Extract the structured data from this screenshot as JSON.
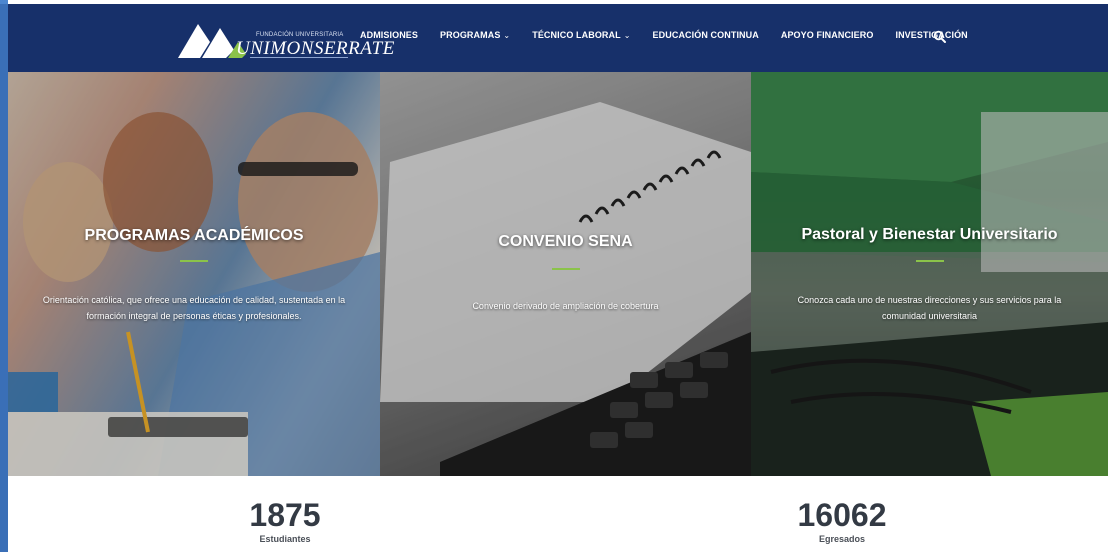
{
  "brand": {
    "foundation_text": "FUNDACIÓN UNIVERSITARIA",
    "name": "UNIMONSERRATE"
  },
  "nav": {
    "items": [
      {
        "label": "ADMISIONES",
        "has_dropdown": false
      },
      {
        "label": "PROGRAMAS",
        "has_dropdown": true
      },
      {
        "label": "TÉCNICO LABORAL",
        "has_dropdown": true
      },
      {
        "label": "EDUCACIÓN CONTINUA",
        "has_dropdown": false
      },
      {
        "label": "APOYO FINANCIERO",
        "has_dropdown": false
      },
      {
        "label": "INVESTIGACIÓN",
        "has_dropdown": false
      }
    ],
    "search_icon": "search-icon"
  },
  "panels": [
    {
      "title": "PROGRAMAS ACADÉMICOS",
      "description": "Orientación católica, que ofrece una educación de calidad, sustentada en la formación integral de personas éticas y profesionales."
    },
    {
      "title": "CONVENIO SENA",
      "description": "Convenio derivado de ampliación de cobertura"
    },
    {
      "title": "Pastoral y Bienestar Universitario",
      "description": "Conozca cada uno de nuestras direcciones y sus servicios para la comunidad universitaria"
    }
  ],
  "stats": [
    {
      "value": "1875",
      "label": "Estudiantes"
    },
    {
      "value": "16062",
      "label": "Egresados"
    }
  ],
  "colors": {
    "nav_bg": "#17306a",
    "accent_bar": "#8bc34a",
    "page_border": "#3a6fb7"
  }
}
